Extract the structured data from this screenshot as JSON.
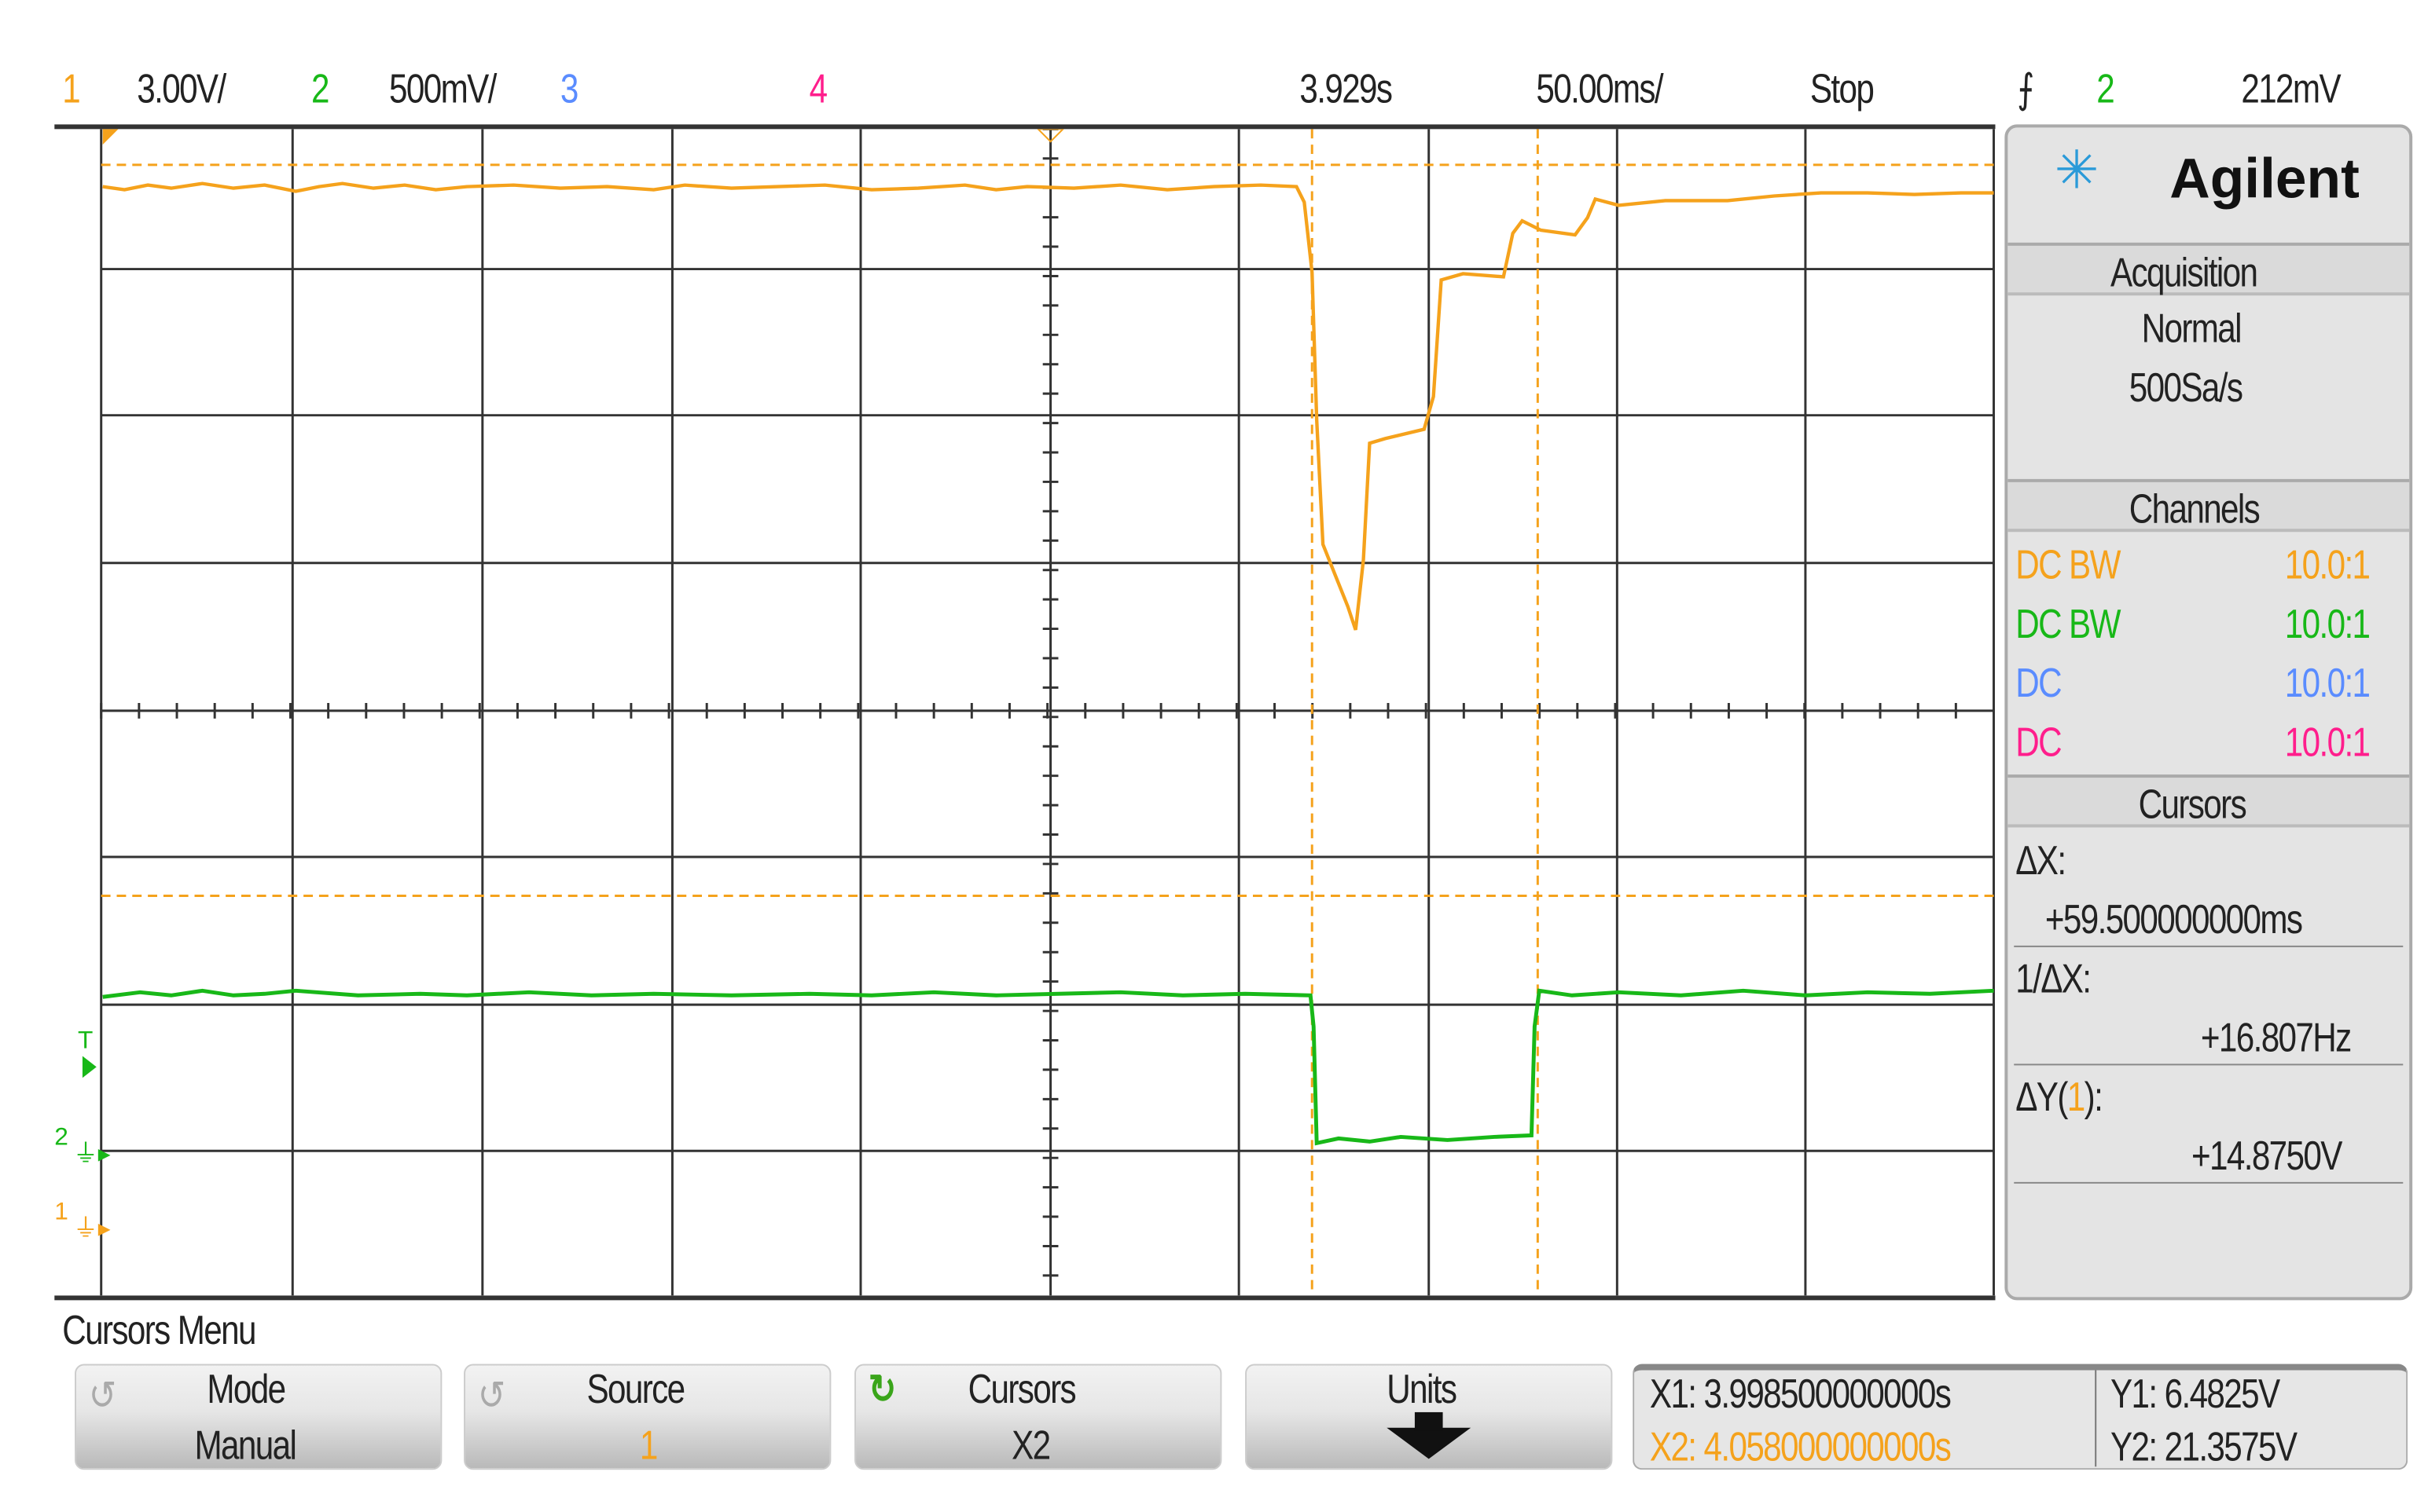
{
  "top_bar": {
    "ch1_num": "1",
    "ch1_scale": "3.00V/",
    "ch2_num": "2",
    "ch2_scale": "500mV/",
    "ch3_num": "3",
    "ch4_num": "4",
    "time_pos": "3.929s",
    "time_scale": "50.00ms/",
    "run_state": "Stop",
    "trigger_source": "2",
    "trigger_level": "212mV"
  },
  "colors": {
    "ch1": "#f5a21c",
    "ch2": "#18b818",
    "ch3": "#5a8cff",
    "ch4": "#ff1e8c"
  },
  "panel": {
    "brand": "Agilent",
    "acquisition": {
      "title": "Acquisition",
      "mode": "Normal",
      "rate": "500Sa/s"
    },
    "channels": {
      "title": "Channels",
      "rows": [
        {
          "coupling": "DC BW",
          "probe": "10.0:1"
        },
        {
          "coupling": "DC BW",
          "probe": "10.0:1"
        },
        {
          "coupling": "DC",
          "probe": "10.0:1"
        },
        {
          "coupling": "DC",
          "probe": "10.0:1"
        }
      ]
    },
    "cursors": {
      "title": "Cursors",
      "dx_label": "ΔX:",
      "dx": "+59.500000000ms",
      "inv_dx_label": "1/ΔX:",
      "inv_dx": "+16.807Hz",
      "dy_label_pre": "ΔY(",
      "dy_src": "1",
      "dy_label_post": "):",
      "dy": "+14.8750V"
    }
  },
  "markers": {
    "trigger": "T",
    "gnd2": "2",
    "gnd1": "1"
  },
  "menu": {
    "title": "Cursors Menu",
    "buttons": [
      {
        "label": "Mode",
        "value": "Manual"
      },
      {
        "label": "Source",
        "value": "1"
      },
      {
        "label": "Cursors",
        "value": "X2"
      },
      {
        "label": "Units"
      }
    ],
    "readout": {
      "x1": "X1: 3.998500000000s",
      "x2": "X2: 4.058000000000s",
      "y1": "Y1: 6.4825V",
      "y2": "Y2: 21.3575V"
    }
  }
}
